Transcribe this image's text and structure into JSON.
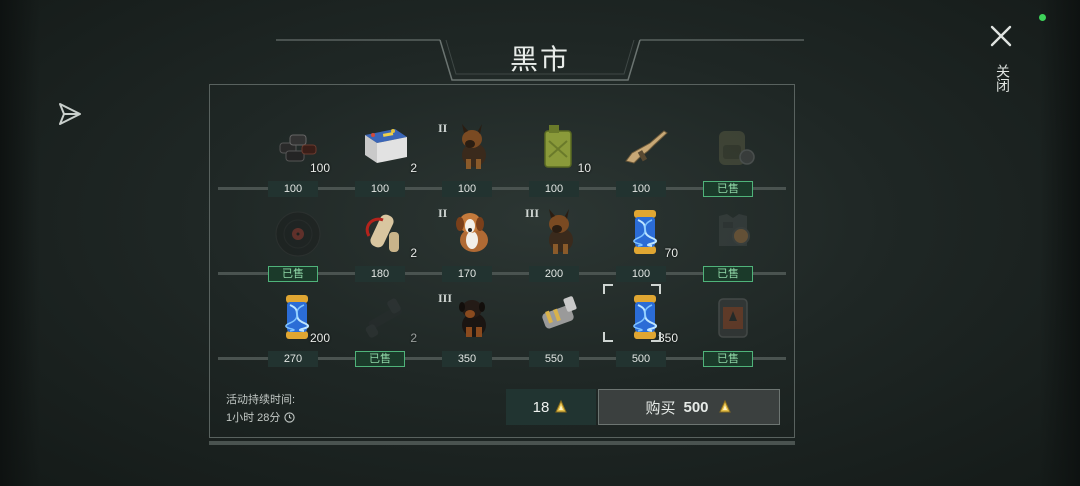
{
  "title": "黑市",
  "close_label": "关闭",
  "timer": {
    "label": "活动持续时间:",
    "value": "1小时 28分"
  },
  "balance": "18",
  "buy": {
    "label": "购买",
    "amount": "500"
  },
  "colors": {
    "sold_border": "#4fb37a",
    "price_bg": "#223330",
    "coin": "#e6c14a",
    "status_dot": "#3ed35a"
  },
  "items": [
    [
      {
        "icon": "coal-icon",
        "qty": "100",
        "tier": "",
        "price": "100",
        "sold": false
      },
      {
        "icon": "car-battery-icon",
        "qty": "2",
        "tier": "",
        "price": "100",
        "sold": false
      },
      {
        "icon": "german-shepherd-dog-icon",
        "qty": "",
        "tier": "II",
        "price": "100",
        "sold": false
      },
      {
        "icon": "jerry-can-icon",
        "qty": "10",
        "tier": "",
        "price": "100",
        "sold": false
      },
      {
        "icon": "assault-rifle-icon",
        "qty": "",
        "tier": "",
        "price": "100",
        "sold": false
      },
      {
        "icon": "backpack-icon",
        "qty": "",
        "tier": "",
        "price": "已售",
        "sold": true
      }
    ],
    [
      {
        "icon": "vinyl-record-icon",
        "qty": "",
        "tier": "",
        "price": "已售",
        "sold": true
      },
      {
        "icon": "scroll-map-icon",
        "qty": "2",
        "tier": "",
        "price": "180",
        "sold": false
      },
      {
        "icon": "saint-bernard-dog-icon",
        "qty": "",
        "tier": "II",
        "price": "170",
        "sold": false
      },
      {
        "icon": "german-shepherd-dog-icon",
        "qty": "",
        "tier": "III",
        "price": "200",
        "sold": false
      },
      {
        "icon": "dna-capsule-icon",
        "qty": "70",
        "tier": "",
        "price": "100",
        "sold": false
      },
      {
        "icon": "body-armor-icon",
        "qty": "",
        "tier": "",
        "price": "已售",
        "sold": true
      }
    ],
    [
      {
        "icon": "dna-capsule-icon",
        "qty": "200",
        "tier": "",
        "price": "270",
        "sold": false
      },
      {
        "icon": "scope-icon",
        "qty": "2",
        "tier": "",
        "price": "已售",
        "sold": true
      },
      {
        "icon": "rottweiler-dog-icon",
        "qty": "",
        "tier": "III",
        "price": "350",
        "sold": false
      },
      {
        "icon": "engine-part-icon",
        "qty": "",
        "tier": "",
        "price": "550",
        "sold": false
      },
      {
        "icon": "dna-capsule-icon",
        "qty": "350",
        "tier": "",
        "price": "500",
        "sold": false
      },
      {
        "icon": "fuel-canister-icon",
        "qty": "",
        "tier": "",
        "price": "已售",
        "sold": true
      }
    ]
  ]
}
